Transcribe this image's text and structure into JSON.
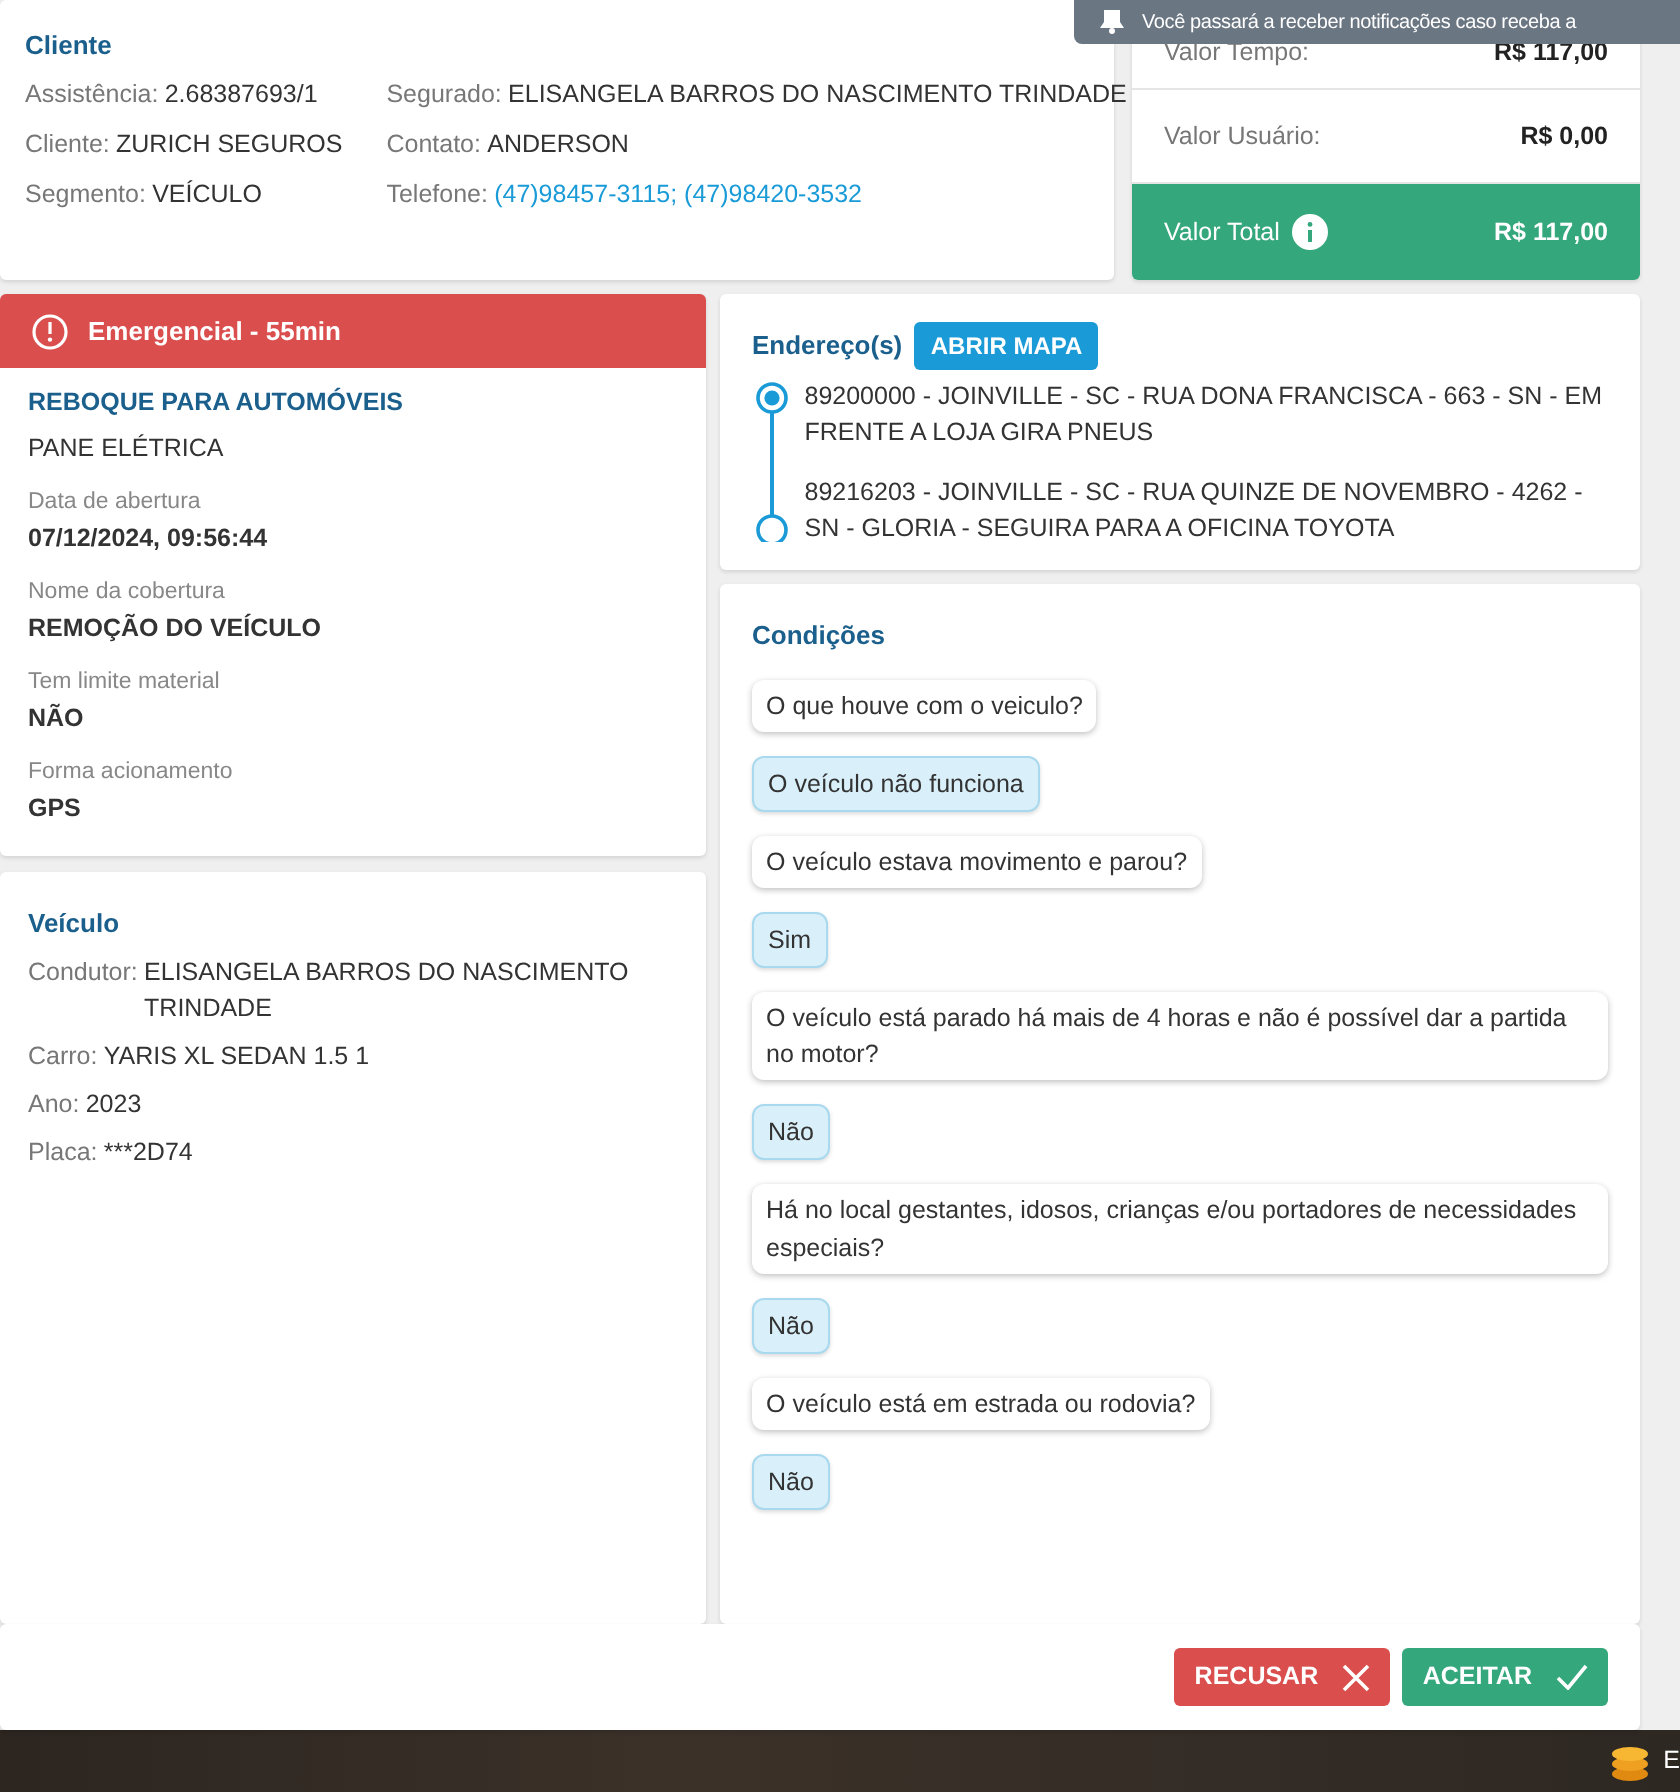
{
  "notification": {
    "text": "Você passará a receber notificações caso receba a"
  },
  "cliente": {
    "title": "Cliente",
    "fields_left": [
      {
        "label": "Assistência:",
        "value": "2.68387693/1",
        "kind": "text"
      },
      {
        "label": "Cliente:",
        "value": "ZURICH SEGUROS",
        "kind": "text"
      },
      {
        "label": "Segmento:",
        "value": "VEÍCULO",
        "kind": "text"
      }
    ],
    "fields_right": [
      {
        "label": "Segurado:",
        "value": "ELISANGELA BARROS DO NASCIMENTO TRINDADE",
        "kind": "text"
      },
      {
        "label": "Contato:",
        "value": "ANDERSON",
        "kind": "text"
      },
      {
        "label": "Telefone:",
        "value": "(47)98457-3115; (47)98420-3532",
        "kind": "link"
      }
    ]
  },
  "valores": [
    {
      "label": "Valor Tempo:",
      "value": "R$ 117,00",
      "kind": "plain"
    },
    {
      "label": "Valor Usuário:",
      "value": "R$ 0,00",
      "kind": "plain"
    },
    {
      "label": "Valor Total",
      "value": "R$ 117,00",
      "kind": "total"
    }
  ],
  "atendimento": {
    "priority": "Emergencial - 55min",
    "service": "REBOQUE PARA AUTOMÓVEIS",
    "problem": "PANE ELÉTRICA",
    "details": [
      {
        "label": "Data de abertura",
        "value": "07/12/2024, 09:56:44"
      },
      {
        "label": "Nome da cobertura",
        "value": "REMOÇÃO DO VEÍCULO"
      },
      {
        "label": "Tem limite material",
        "value": "NÃO"
      },
      {
        "label": "Forma acionamento",
        "value": "GPS"
      }
    ]
  },
  "veiculo": {
    "title": "Veículo",
    "fields": [
      {
        "label": "Condutor:",
        "value": "ELISANGELA BARROS DO NASCIMENTO TRINDADE"
      },
      {
        "label": "Carro:",
        "value": "YARIS XL SEDAN 1.5 1"
      },
      {
        "label": "Ano:",
        "value": "2023"
      },
      {
        "label": "Placa:",
        "value": "***2D74"
      }
    ]
  },
  "enderecos": {
    "title": "Endereço(s)",
    "button": "ABRIR MAPA",
    "items": [
      {
        "text": "89200000 - JOINVILLE - SC - RUA DONA FRANCISCA - 663 - SN - EM FRENTE A LOJA GIRA PNEUS",
        "kind": "origin"
      },
      {
        "text": "89216203 - JOINVILLE - SC - RUA QUINZE DE NOVEMBRO - 4262 - SN - GLORIA - SEGUIRA PARA A OFICINA TOYOTA",
        "kind": "destination"
      }
    ]
  },
  "condicoes": {
    "title": "Condições",
    "items": [
      {
        "kind": "question",
        "text": "O que houve com o veiculo?"
      },
      {
        "kind": "answer",
        "text": "O veículo não funciona"
      },
      {
        "kind": "question",
        "text": "O veículo estava movimento e parou?"
      },
      {
        "kind": "answer",
        "text": "Sim"
      },
      {
        "kind": "question",
        "text": "O veículo está parado há mais de 4 horas e não é possível dar a partida no motor?"
      },
      {
        "kind": "answer",
        "text": "Não"
      },
      {
        "kind": "question",
        "text": "Há no local gestantes, idosos, crianças e/ou portadores de necessidades especiais?"
      },
      {
        "kind": "answer",
        "text": "Não"
      },
      {
        "kind": "question",
        "text": "O veículo está em estrada ou rodovia?"
      },
      {
        "kind": "answer",
        "text": "Não"
      }
    ]
  },
  "actions": [
    {
      "label": "RECUSAR",
      "kind": "reject"
    },
    {
      "label": "ACEITAR",
      "kind": "accept"
    }
  ],
  "taskbar": {
    "text": "E"
  }
}
